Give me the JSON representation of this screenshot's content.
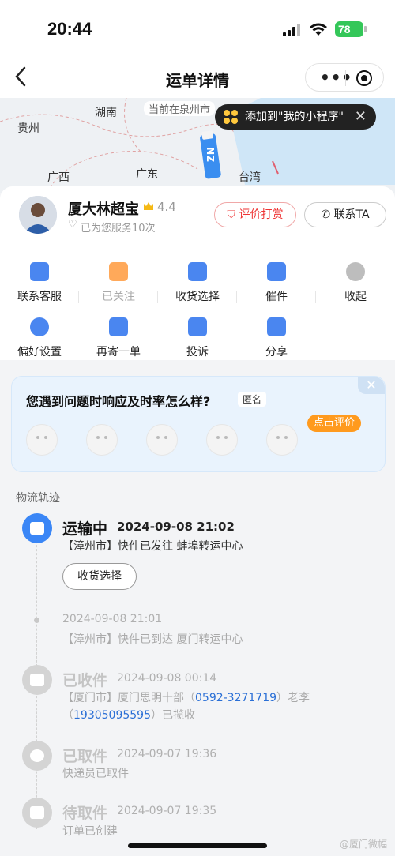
{
  "status_bar": {
    "time": "20:44",
    "battery": "78"
  },
  "nav": {
    "title": "运单详情"
  },
  "map": {
    "current_location": "当前在泉州市",
    "labels": [
      "湖南",
      "贵州",
      "广西",
      "广东",
      "台湾"
    ],
    "popup_text": "添加到\"我的小程序\""
  },
  "courier": {
    "name": "厦大林超宝",
    "rating": "4.4",
    "served": "已为您服务10次",
    "rate_button": "评价打赏",
    "contact_button": "联系TA"
  },
  "actions": [
    {
      "label": "联系客服",
      "icon": "chat-icon"
    },
    {
      "label": "已关注",
      "icon": "heart-check-icon"
    },
    {
      "label": "收货选择",
      "icon": "checkbox-icon"
    },
    {
      "label": "催件",
      "icon": "megaphone-icon"
    },
    {
      "label": "收起",
      "icon": "collapse-icon"
    },
    {
      "label": "偏好设置",
      "icon": "settings-icon"
    },
    {
      "label": "再寄一单",
      "icon": "package-icon"
    },
    {
      "label": "投诉",
      "icon": "complaint-icon"
    },
    {
      "label": "分享",
      "icon": "share-icon"
    }
  ],
  "feedback": {
    "question": "您遇到问题时响应及时率怎么样?",
    "anon": "匿名",
    "cta": "点击评价"
  },
  "section_title": "物流轨迹",
  "tracking": [
    {
      "status": "运输中",
      "time": "2024-09-08 21:02",
      "desc": "【漳州市】快件已发往 蚌埠转运中心"
    },
    {
      "status": "",
      "time": "2024-09-08 21:01",
      "desc": "【漳州市】快件已到达 厦门转运中心"
    },
    {
      "status": "已收件",
      "time": "2024-09-08 00:14",
      "desc_prefix": "【厦门市】厦门思明十部（",
      "phone1": "0592-3271719",
      "desc_mid": "）老李（",
      "phone2": "19305095595",
      "desc_suffix": "）已揽收"
    },
    {
      "status": "已取件",
      "time": "2024-09-07 19:36",
      "desc": "快递员已取件"
    },
    {
      "status": "待取件",
      "time": "2024-09-07 19:35",
      "desc": "订单已创建"
    }
  ],
  "receive_button": "收货选择",
  "watermark": "@厦门微幅"
}
